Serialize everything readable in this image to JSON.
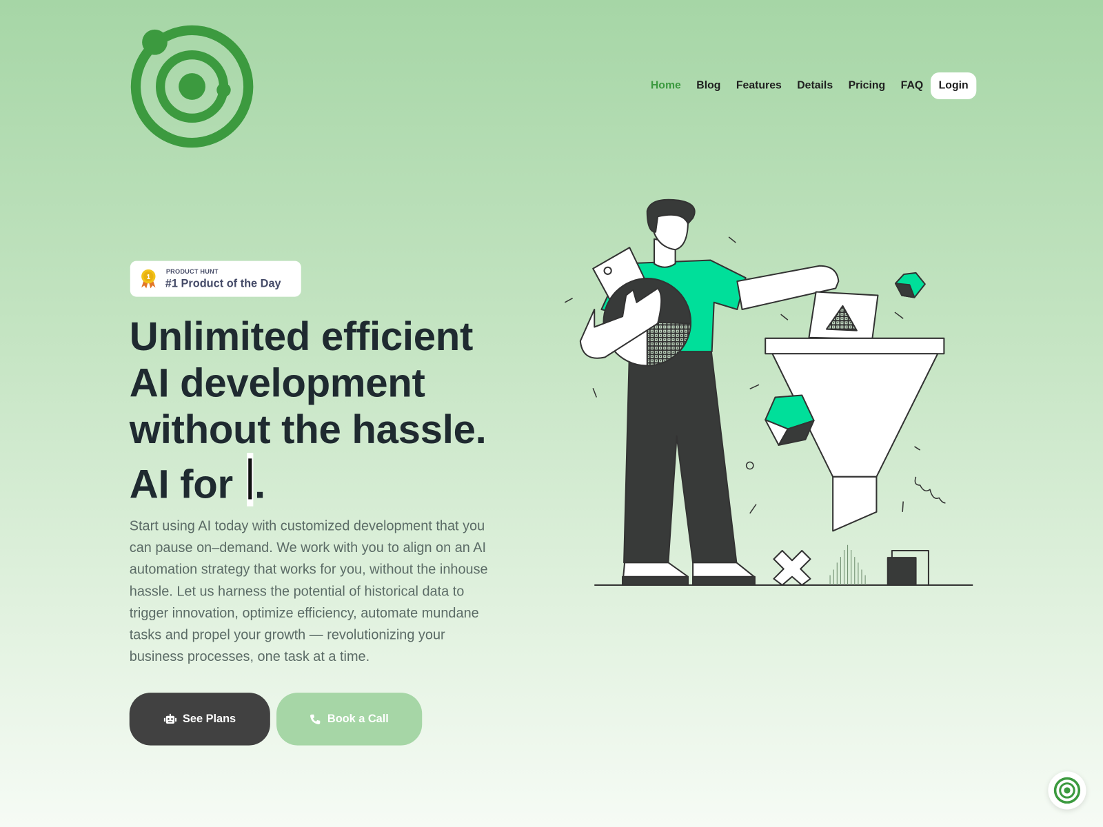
{
  "brand": {
    "logo_icon": "concentric-target-logo",
    "color": "#3c9a3f"
  },
  "nav": {
    "items": [
      {
        "label": "Home",
        "active": true
      },
      {
        "label": "Blog"
      },
      {
        "label": "Features"
      },
      {
        "label": "Details"
      },
      {
        "label": "Pricing"
      },
      {
        "label": "FAQ"
      }
    ],
    "login": "Login"
  },
  "badge": {
    "icon": "medal-icon",
    "kicker": "PRODUCT HUNT",
    "title": "#1 Product of the Day"
  },
  "hero": {
    "headline_lines": [
      "Unlimited efficient",
      "AI development",
      "without the hassle."
    ],
    "headline_prefix": "AI for ",
    "headline_suffix": ".",
    "body": "Start using AI today with customized development that you can pause on–demand. We work with you to align on an AI automation strategy that works for you, without the inhouse hassle. Let us harness the potential of historical data to trigger innovation, optimize efficiency, automate mundane tasks and propel your growth — revolutionizing your business processes, one task at a time."
  },
  "buttons": {
    "primary": {
      "label": "See Plans",
      "icon": "robot-icon"
    },
    "secondary": {
      "label": "Book a Call",
      "icon": "phone-icon"
    }
  },
  "colors": {
    "dark": "#414141",
    "accent": "#00df9a",
    "light_green": "#a6d6a6"
  }
}
